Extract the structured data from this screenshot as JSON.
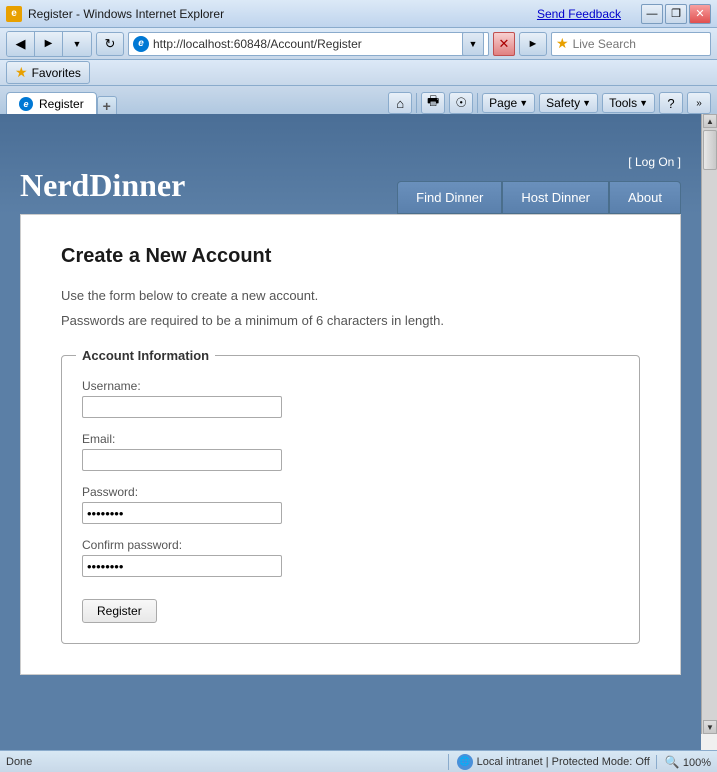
{
  "titlebar": {
    "title": "Register - Windows Internet Explorer",
    "send_feedback": "Send Feedback",
    "buttons": {
      "minimize": "—",
      "restore": "❐",
      "close": "✕"
    }
  },
  "addressbar": {
    "url": "http://localhost:60848/Account/Register",
    "live_search_placeholder": "Live Search",
    "ie_icon": "e"
  },
  "favorites": {
    "button_label": "Favorites"
  },
  "tab": {
    "label": "Register",
    "ie_icon": "e"
  },
  "toolbar": {
    "page_label": "Page",
    "safety_label": "Safety",
    "tools_label": "Tools"
  },
  "header": {
    "logo": "NerdDinner",
    "logon_text": "[ Log On ]",
    "nav": [
      {
        "label": "Find Dinner"
      },
      {
        "label": "Host Dinner"
      },
      {
        "label": "About"
      }
    ]
  },
  "content": {
    "title": "Create a New Account",
    "desc1": "Use the form below to create a new account.",
    "desc2": "Passwords are required to be a minimum of 6 characters in length.",
    "fieldset_legend": "Account Information",
    "fields": [
      {
        "label": "Username:",
        "type": "text",
        "value": "",
        "placeholder": ""
      },
      {
        "label": "Email:",
        "type": "text",
        "value": "",
        "placeholder": ""
      },
      {
        "label": "Password:",
        "type": "password",
        "value": "••••••",
        "placeholder": ""
      },
      {
        "label": "Confirm password:",
        "type": "password",
        "value": "••••••",
        "placeholder": ""
      }
    ],
    "register_button": "Register"
  },
  "statusbar": {
    "status": "Done",
    "zone": "Local intranet | Protected Mode: Off",
    "zoom": "100%"
  }
}
